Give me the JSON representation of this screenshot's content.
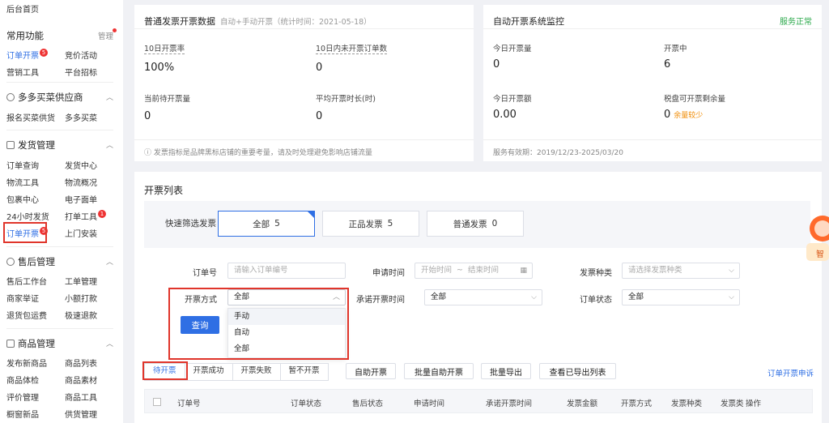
{
  "sidebar": {
    "top_item": "后台首页",
    "common": {
      "title": "常用功能",
      "manage": "管理",
      "items": [
        {
          "label": "订单开票",
          "badge": "5",
          "active": true
        },
        {
          "label": "竞价活动"
        },
        {
          "label": "营销工具"
        },
        {
          "label": "平台招标"
        }
      ]
    },
    "groups": [
      {
        "title": "多多买菜供应商",
        "items": [
          "报名买菜供货",
          "多多买菜"
        ]
      },
      {
        "title": "发货管理",
        "items": [
          "订单查询",
          "发货中心",
          "物流工具",
          "物流概况",
          "包裹中心",
          "电子面单",
          "24小时发货",
          "打单工具",
          "订单开票",
          "上门安装"
        ],
        "badges": {
          "7": "1",
          "8": "5"
        }
      },
      {
        "title": "售后管理",
        "items": [
          "售后工作台",
          "工单管理",
          "商家举证",
          "小额打款",
          "退货包运费",
          "极速退款"
        ]
      },
      {
        "title": "商品管理",
        "items": [
          "发布新商品",
          "商品列表",
          "商品体检",
          "商品素材",
          "评价管理",
          "商品工具",
          "橱窗新品",
          "供货管理"
        ]
      }
    ]
  },
  "stats_card": {
    "title": "普通发票开票数据",
    "subtitle": "自动+手动开票（统计时间：2021-05-18）",
    "metrics": [
      {
        "label": "10日开票率",
        "value": "100%"
      },
      {
        "label": "10日内未开票订单数",
        "value": "0"
      },
      {
        "label": "当前待开票量",
        "value": "0"
      },
      {
        "label": "平均开票时长(时)",
        "value": "0"
      }
    ],
    "footer": "ⓘ 发票指标是品牌黑标店铺的重要考量，请及时处理避免影响店铺流量"
  },
  "monitor_card": {
    "title": "自动开票系统监控",
    "status": "服务正常",
    "metrics": [
      {
        "label": "今日开票量",
        "value": "0"
      },
      {
        "label": "开票中",
        "value": "6"
      },
      {
        "label": "今日开票额",
        "value": "0.00"
      },
      {
        "label": "税盘可开票剩余量",
        "value": "0",
        "tag": "余量较少"
      }
    ],
    "footer": "服务有效期：2019/12/23-2025/03/20"
  },
  "invoice_list": {
    "title": "开票列表",
    "quick_filter_label": "快速筛选发票",
    "quick_filters": [
      {
        "label": "全部",
        "count": "5",
        "active": true
      },
      {
        "label": "正品发票",
        "count": "5"
      },
      {
        "label": "普通发票",
        "count": "0"
      }
    ],
    "form": {
      "order_no": {
        "label": "订单号",
        "placeholder": "请输入订单编号"
      },
      "apply_time": {
        "label": "申请时间",
        "start": "开始时间",
        "sep": "~",
        "end": "结束时间"
      },
      "invoice_type": {
        "label": "发票种类",
        "placeholder": "请选择发票种类"
      },
      "issue_method": {
        "label": "开票方式",
        "value": "全部",
        "options": [
          "手动",
          "自动",
          "全部"
        ]
      },
      "promise_time": {
        "label": "承诺开票时间",
        "value": "全部"
      },
      "order_status": {
        "label": "订单状态",
        "value": "全部"
      },
      "query_button": "查询"
    },
    "tabs": [
      "待开票",
      "开票成功",
      "开票失败",
      "暂不开票"
    ],
    "actions": [
      "自助开票",
      "批量自助开票",
      "批量导出",
      "查看已导出列表"
    ],
    "appeal_link": "订单开票申诉",
    "columns": [
      "订单号",
      "订单状态",
      "售后状态",
      "申请时间",
      "承诺开票时间",
      "发票金额",
      "开票方式",
      "发票种类",
      "发票类",
      "操作"
    ]
  },
  "float_widget": {
    "text": "智"
  },
  "colors": {
    "primary": "#2f6fe4",
    "success": "#2aa84a",
    "warning": "#f08a00",
    "highlight_box": "#e0352b"
  }
}
